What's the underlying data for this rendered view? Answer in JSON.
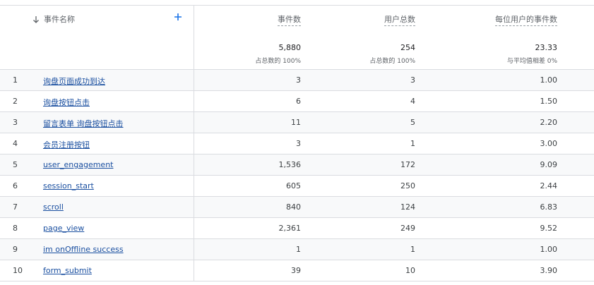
{
  "header": {
    "name_column": "事件名称",
    "metrics": [
      {
        "label": "事件数",
        "total": "5,880",
        "sub": "占总数的 100%"
      },
      {
        "label": "用户总数",
        "total": "254",
        "sub": "占总数的 100%"
      },
      {
        "label": "每位用户的事件数",
        "total": "23.33",
        "sub": "与平均值相差 0%"
      }
    ]
  },
  "rows": [
    {
      "idx": "1",
      "name": "询盘页面成功到达",
      "events": "3",
      "users": "3",
      "per_user": "1.00"
    },
    {
      "idx": "2",
      "name": "询盘按钮点击",
      "events": "6",
      "users": "4",
      "per_user": "1.50"
    },
    {
      "idx": "3",
      "name": "留言表单 询盘按钮点击",
      "events": "11",
      "users": "5",
      "per_user": "2.20"
    },
    {
      "idx": "4",
      "name": "会员注册按钮",
      "events": "3",
      "users": "1",
      "per_user": "3.00"
    },
    {
      "idx": "5",
      "name": "user_engagement",
      "events": "1,536",
      "users": "172",
      "per_user": "9.09"
    },
    {
      "idx": "6",
      "name": "session_start",
      "events": "605",
      "users": "250",
      "per_user": "2.44"
    },
    {
      "idx": "7",
      "name": "scroll",
      "events": "840",
      "users": "124",
      "per_user": "6.83"
    },
    {
      "idx": "8",
      "name": "page_view",
      "events": "2,361",
      "users": "249",
      "per_user": "9.52"
    },
    {
      "idx": "9",
      "name": "im onOffline success",
      "events": "1",
      "users": "1",
      "per_user": "1.00"
    },
    {
      "idx": "10",
      "name": "form_submit",
      "events": "39",
      "users": "10",
      "per_user": "3.90"
    }
  ],
  "colors": {
    "link": "#1a4fa0",
    "accent": "#1a73e8",
    "border": "#dadce0"
  },
  "icons": {
    "sort": "arrow-down-icon",
    "add": "plus-icon"
  }
}
